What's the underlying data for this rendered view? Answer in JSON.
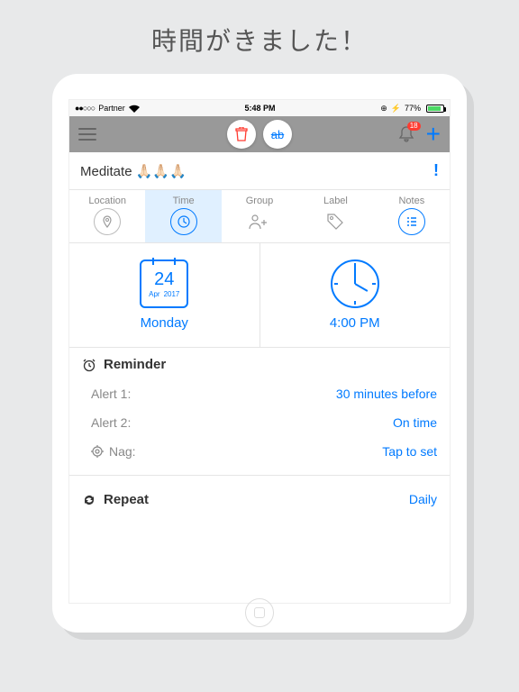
{
  "page_title": "時間がきました！",
  "statusbar": {
    "carrier": "Partner",
    "time": "5:48 PM",
    "battery": "77%"
  },
  "appbar": {
    "badge": "18"
  },
  "task": {
    "title": "Meditate 🙏🏻🙏🏻🙏🏻",
    "priority": "!"
  },
  "tabs": {
    "location": "Location",
    "time": "Time",
    "group": "Group",
    "label": "Label",
    "notes": "Notes"
  },
  "date": {
    "day": "24",
    "month": "Apr",
    "year": "2017",
    "weekday": "Monday"
  },
  "time": {
    "display": "4:00 PM"
  },
  "reminder": {
    "heading": "Reminder",
    "alert1_k": "Alert 1:",
    "alert1_v": "30 minutes before",
    "alert2_k": "Alert 2:",
    "alert2_v": "On time",
    "nag_k": "Nag:",
    "nag_v": "Tap to set"
  },
  "repeat": {
    "heading": "Repeat",
    "value": "Daily"
  }
}
